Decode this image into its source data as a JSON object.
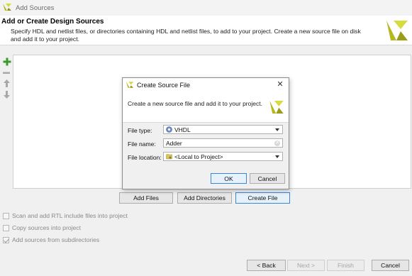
{
  "window": {
    "title": "Add Sources",
    "heading": "Add or Create Design Sources",
    "description": "Specify HDL and netlist files, or directories containing HDL and netlist files, to add to your project. Create a new source file on disk and add it to your project."
  },
  "toolbar": {
    "add_icon": "plus-icon",
    "remove_icon": "minus-icon",
    "up_icon": "arrow-up-icon",
    "down_icon": "arrow-down-icon"
  },
  "actions": {
    "add_files": "Add Files",
    "add_directories": "Add Directories",
    "create_file": "Create File"
  },
  "options": [
    {
      "label": "Scan and add RTL include files into project",
      "checked": false
    },
    {
      "label": "Copy sources into project",
      "checked": false
    },
    {
      "label": "Add sources from subdirectories",
      "checked": true
    }
  ],
  "nav": {
    "back": "< Back",
    "next": "Next >",
    "finish": "Finish",
    "cancel": "Cancel"
  },
  "dialog": {
    "title": "Create Source File",
    "description": "Create a new source file and add it to your project.",
    "file_type_label": "File type:",
    "file_type_value": "VHDL",
    "file_name_label": "File name:",
    "file_name_value": "Adder",
    "file_location_label": "File location:",
    "file_location_value": "<Local to Project>",
    "ok": "OK",
    "cancel": "Cancel"
  },
  "colors": {
    "brand_yellow": "#c8cc2a",
    "brand_dark": "#8a8c1c",
    "focus_blue": "#3b86d8",
    "add_green": "#3a9a2a"
  }
}
